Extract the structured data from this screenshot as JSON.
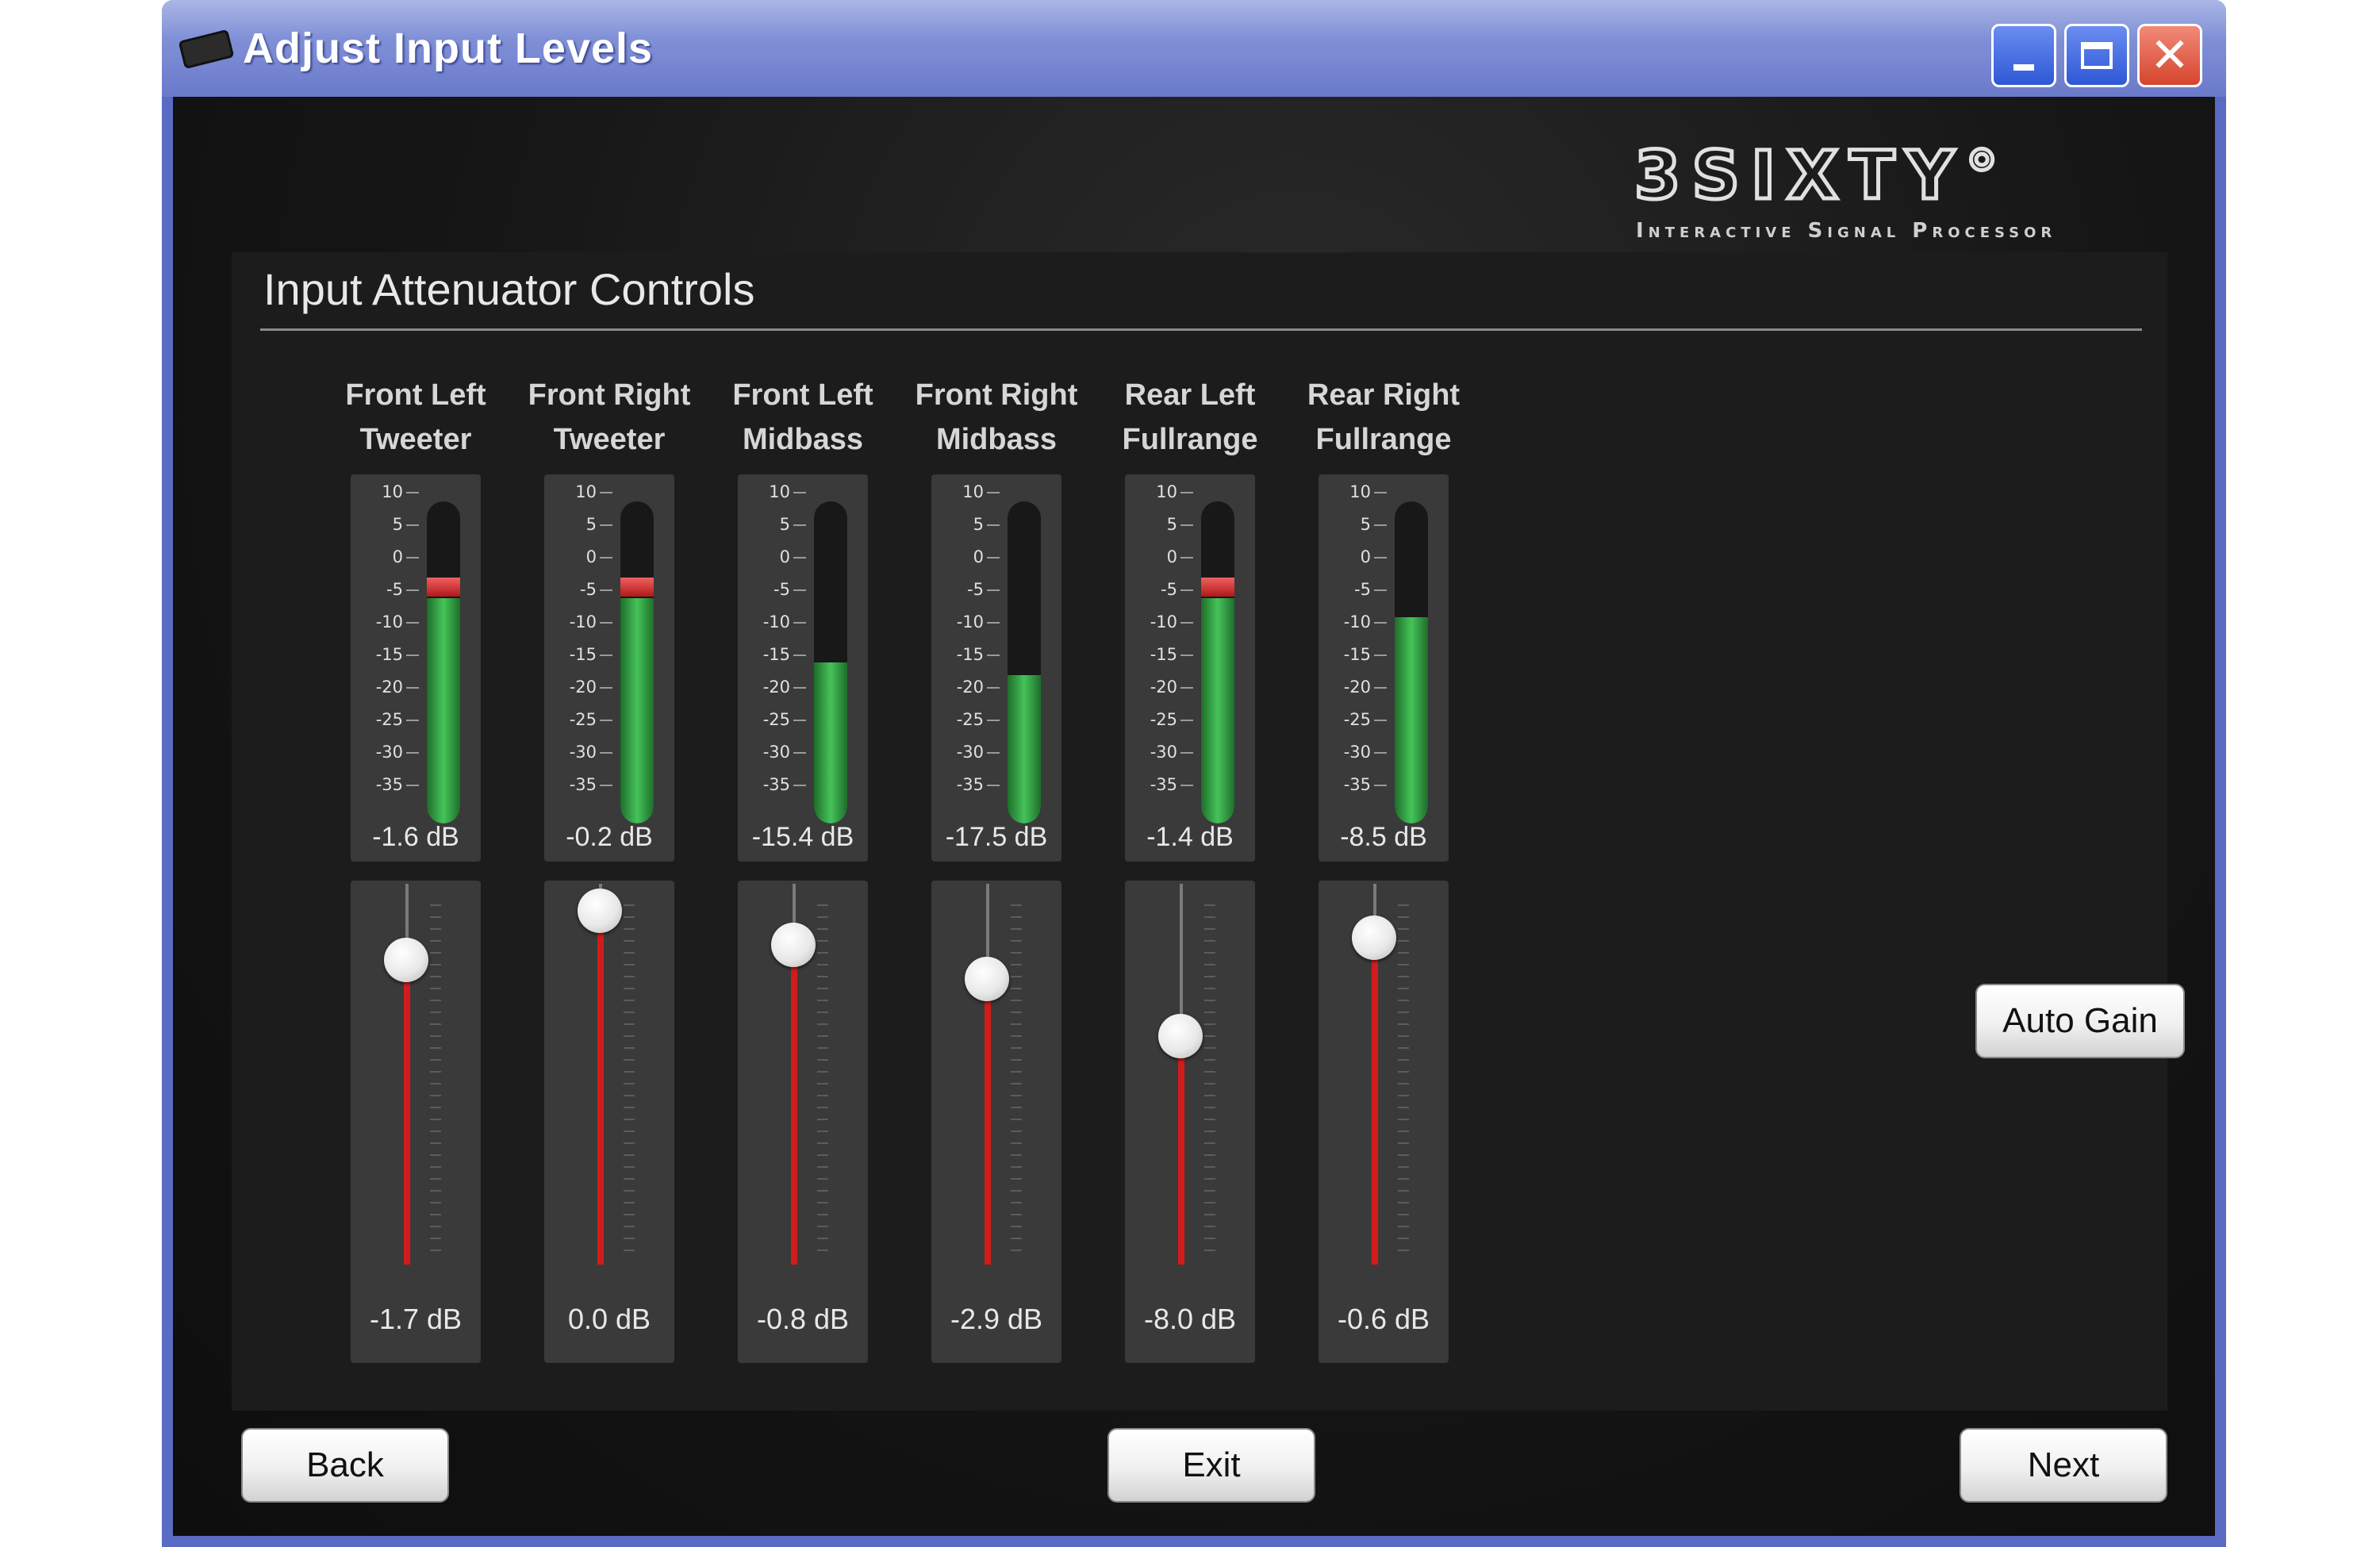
{
  "window": {
    "title": "Adjust Input Levels",
    "icons": {
      "app": "sound-card-icon",
      "minimize": "minimize-icon",
      "maximize": "maximize-icon",
      "close": "close-icon"
    }
  },
  "logo": {
    "main": "3SIXTY",
    "degree": "°",
    "subtitle": "Interactive Signal Processor"
  },
  "panel": {
    "title": "Input Attenuator Controls"
  },
  "meter_scale": [
    "10",
    "5",
    "0",
    "-5",
    "-10",
    "-15",
    "-20",
    "-25",
    "-30",
    "-35"
  ],
  "channels": [
    {
      "label_line1": "Front Left",
      "label_line2": "Tweeter",
      "meter_value": "-1.6 dB",
      "meter_fill": 0.7,
      "peak": true,
      "fader_value": "-1.7 dB",
      "fader_level": 0.87
    },
    {
      "label_line1": "Front Right",
      "label_line2": "Tweeter",
      "meter_value": "-0.2 dB",
      "meter_fill": 0.7,
      "peak": true,
      "fader_value": "0.0 dB",
      "fader_level": 1.0
    },
    {
      "label_line1": "Front Left",
      "label_line2": "Midbass",
      "meter_value": "-15.4 dB",
      "meter_fill": 0.5,
      "peak": false,
      "fader_value": "-0.8 dB",
      "fader_level": 0.91
    },
    {
      "label_line1": "Front Right",
      "label_line2": "Midbass",
      "meter_value": "-17.5 dB",
      "meter_fill": 0.46,
      "peak": false,
      "fader_value": "-2.9 dB",
      "fader_level": 0.82
    },
    {
      "label_line1": "Rear Left",
      "label_line2": "Fullrange",
      "meter_value": "-1.4 dB",
      "meter_fill": 0.7,
      "peak": true,
      "fader_value": "-8.0 dB",
      "fader_level": 0.67
    },
    {
      "label_line1": "Rear Right",
      "label_line2": "Fullrange",
      "meter_value": "-8.5 dB",
      "meter_fill": 0.64,
      "peak": false,
      "fader_value": "-0.6 dB",
      "fader_level": 0.93
    }
  ],
  "buttons": {
    "auto_gain": "Auto Gain",
    "back": "Back",
    "exit": "Exit",
    "next": "Next"
  },
  "colors": {
    "meter_green": "#46c35a",
    "peak_red": "#d21c1c",
    "fader_red": "#d21c1c",
    "titlebar": "#7f8fd5"
  }
}
